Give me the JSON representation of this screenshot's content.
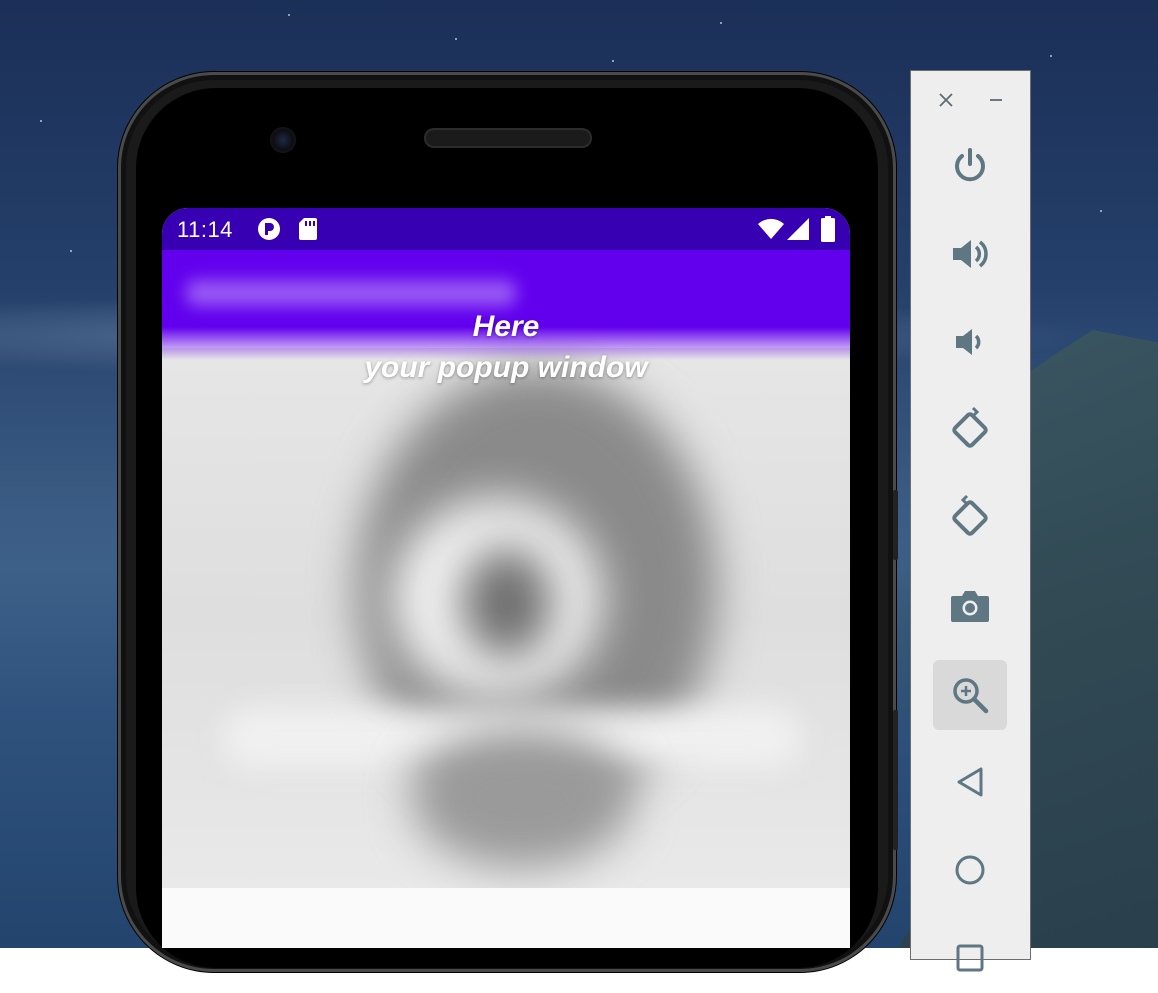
{
  "status_bar": {
    "time": "11:14",
    "left_icons": [
      "profile-badge-icon",
      "sd-card-icon"
    ],
    "right_icons": [
      "wifi-icon",
      "cell-signal-icon",
      "battery-icon"
    ]
  },
  "popup": {
    "line1": "Here",
    "line2": "your popup window"
  },
  "emulator_panel": {
    "window_controls": [
      "close-icon",
      "minimize-icon"
    ],
    "tools": [
      {
        "name": "power-button",
        "icon": "power-icon"
      },
      {
        "name": "volume-up-button",
        "icon": "volume-up-icon"
      },
      {
        "name": "volume-down-button",
        "icon": "volume-down-icon"
      },
      {
        "name": "rotate-left-button",
        "icon": "rotate-left-icon"
      },
      {
        "name": "rotate-right-button",
        "icon": "rotate-right-icon"
      },
      {
        "name": "screenshot-button",
        "icon": "camera-icon"
      },
      {
        "name": "zoom-button",
        "icon": "zoom-in-icon",
        "active": true
      },
      {
        "name": "back-button",
        "icon": "back-triangle-icon"
      },
      {
        "name": "home-button",
        "icon": "home-circle-icon"
      },
      {
        "name": "overview-button",
        "icon": "overview-square-icon"
      }
    ]
  },
  "colors": {
    "status_bar": "#3700b3",
    "app_bar": "#6200ee",
    "panel_icon": "#5f7782",
    "panel_bg": "#eeeeee"
  }
}
